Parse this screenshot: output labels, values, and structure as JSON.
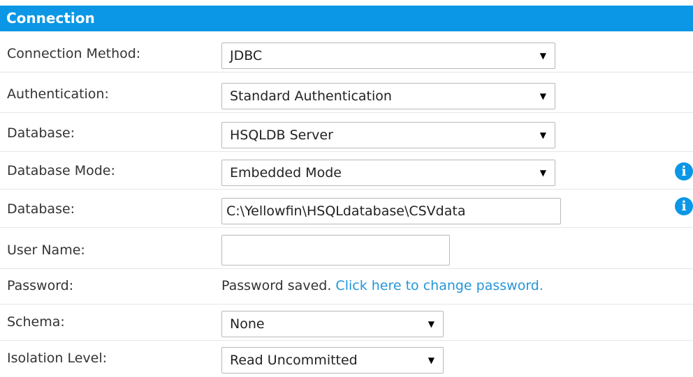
{
  "header": {
    "title": "Connection"
  },
  "colors": {
    "accent": "#0b97e6",
    "link": "#2596d9"
  },
  "rows": {
    "connection_method": {
      "label": "Connection Method:",
      "value": "JDBC"
    },
    "authentication": {
      "label": "Authentication:",
      "value": "Standard Authentication"
    },
    "database": {
      "label": "Database:",
      "value": "HSQLDB Server"
    },
    "database_mode": {
      "label": "Database Mode:",
      "value": "Embedded Mode"
    },
    "database_path": {
      "label": "Database:",
      "value": "C:\\Yellowfin\\HSQLdatabase\\CSVdata"
    },
    "user_name": {
      "label": "User Name:",
      "value": ""
    },
    "password": {
      "label": "Password:",
      "saved_text": "Password saved.",
      "change_link": "Click here to change password."
    },
    "schema": {
      "label": "Schema:",
      "value": "None"
    },
    "isolation_level": {
      "label": "Isolation Level:",
      "value": "Read Uncommitted"
    }
  },
  "icons": {
    "dropdown_arrow": "▼",
    "info": "i"
  }
}
